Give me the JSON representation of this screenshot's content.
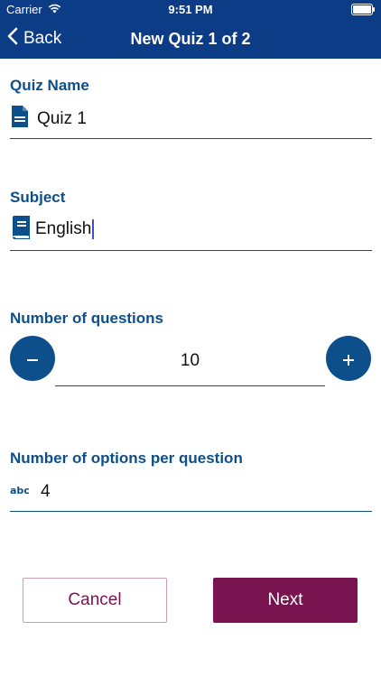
{
  "status": {
    "carrier": "Carrier",
    "time": "9:51 PM"
  },
  "nav": {
    "back_label": "Back",
    "title": "New Quiz 1 of 2"
  },
  "form": {
    "quiz_name": {
      "label": "Quiz Name",
      "value": "Quiz 1",
      "icon": "document-icon"
    },
    "subject": {
      "label": "Subject",
      "value": "English",
      "icon": "book-icon"
    },
    "questions": {
      "label": "Number of questions",
      "value": "10"
    },
    "options": {
      "label": "Number of options per question",
      "value": "4",
      "icon": "abc-icon"
    }
  },
  "buttons": {
    "cancel": "Cancel",
    "next": "Next"
  },
  "colors": {
    "nav_bg": "#0d3c86",
    "accent": "#0d4f8b",
    "primary_button": "#7a1450"
  }
}
